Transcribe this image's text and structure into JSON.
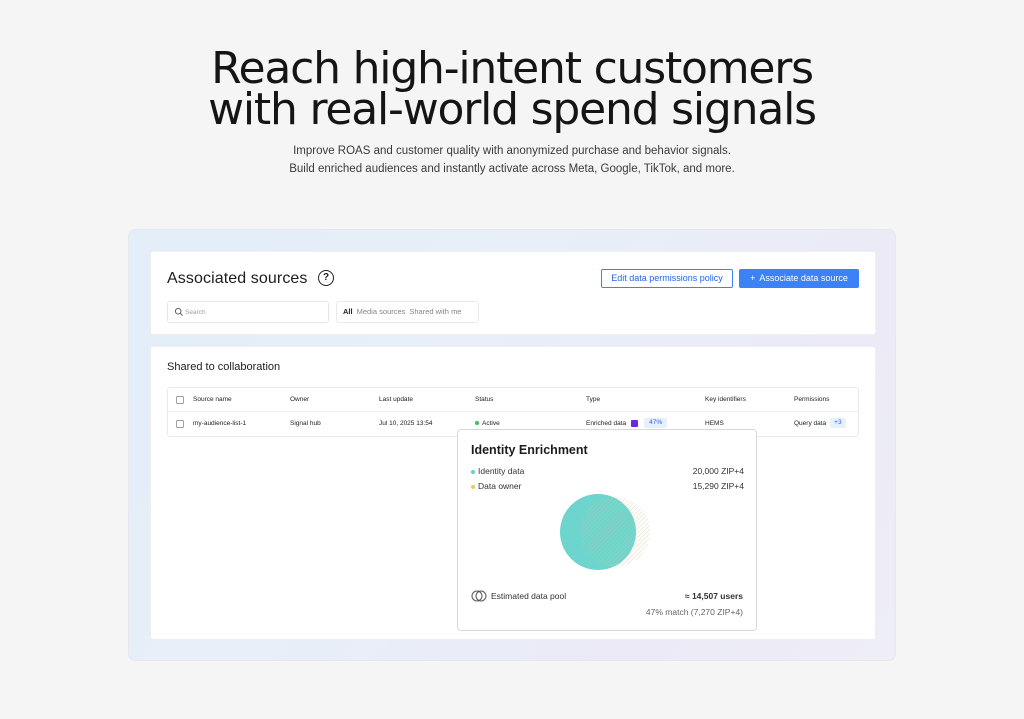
{
  "hero": {
    "title_line1": "Reach high-intent customers",
    "title_line2": "with real-world spend signals",
    "subtitle_line1": "Improve ROAS and customer quality with anonymized purchase and behavior signals.",
    "subtitle_line2": "Build enriched audiences and instantly activate across Meta, Google, TikTok, and more."
  },
  "sources": {
    "title": "Associated sources",
    "help_glyph": "?",
    "edit_button": "Edit data permissions policy",
    "associate_button": "Associate data source",
    "associate_plus": "+",
    "search_placeholder": "Search",
    "filters": [
      "All",
      "Media sources",
      "Shared with me"
    ]
  },
  "shared": {
    "title": "Shared to collaboration",
    "columns": [
      "Source name",
      "Owner",
      "Last update",
      "Status",
      "Type",
      "Key identifiers",
      "Permissions"
    ],
    "row": {
      "source_name": "my-audience-list-1",
      "owner": "Signal hub",
      "last_update": "Jul 10, 2025 13:54",
      "status": "Active",
      "type": "Enriched data",
      "match_badge": "47%",
      "key_identifiers": "HEMS",
      "permissions": "Query data",
      "more_badge": "+3"
    }
  },
  "enrichment": {
    "title": "Identity Enrichment",
    "identity_label": "Identity data",
    "identity_value": "20,000 ZIP+4",
    "owner_label": "Data owner",
    "owner_value": "15,290 ZIP+4",
    "pool_label": "Estimated data pool",
    "pool_users": "≈ 14,507 users",
    "pool_match": "47% match (7,270 ZIP+4)",
    "colors": {
      "identity": "#5fd3cc",
      "owner": "#f2c94c",
      "accent": "#3b82f6"
    }
  }
}
